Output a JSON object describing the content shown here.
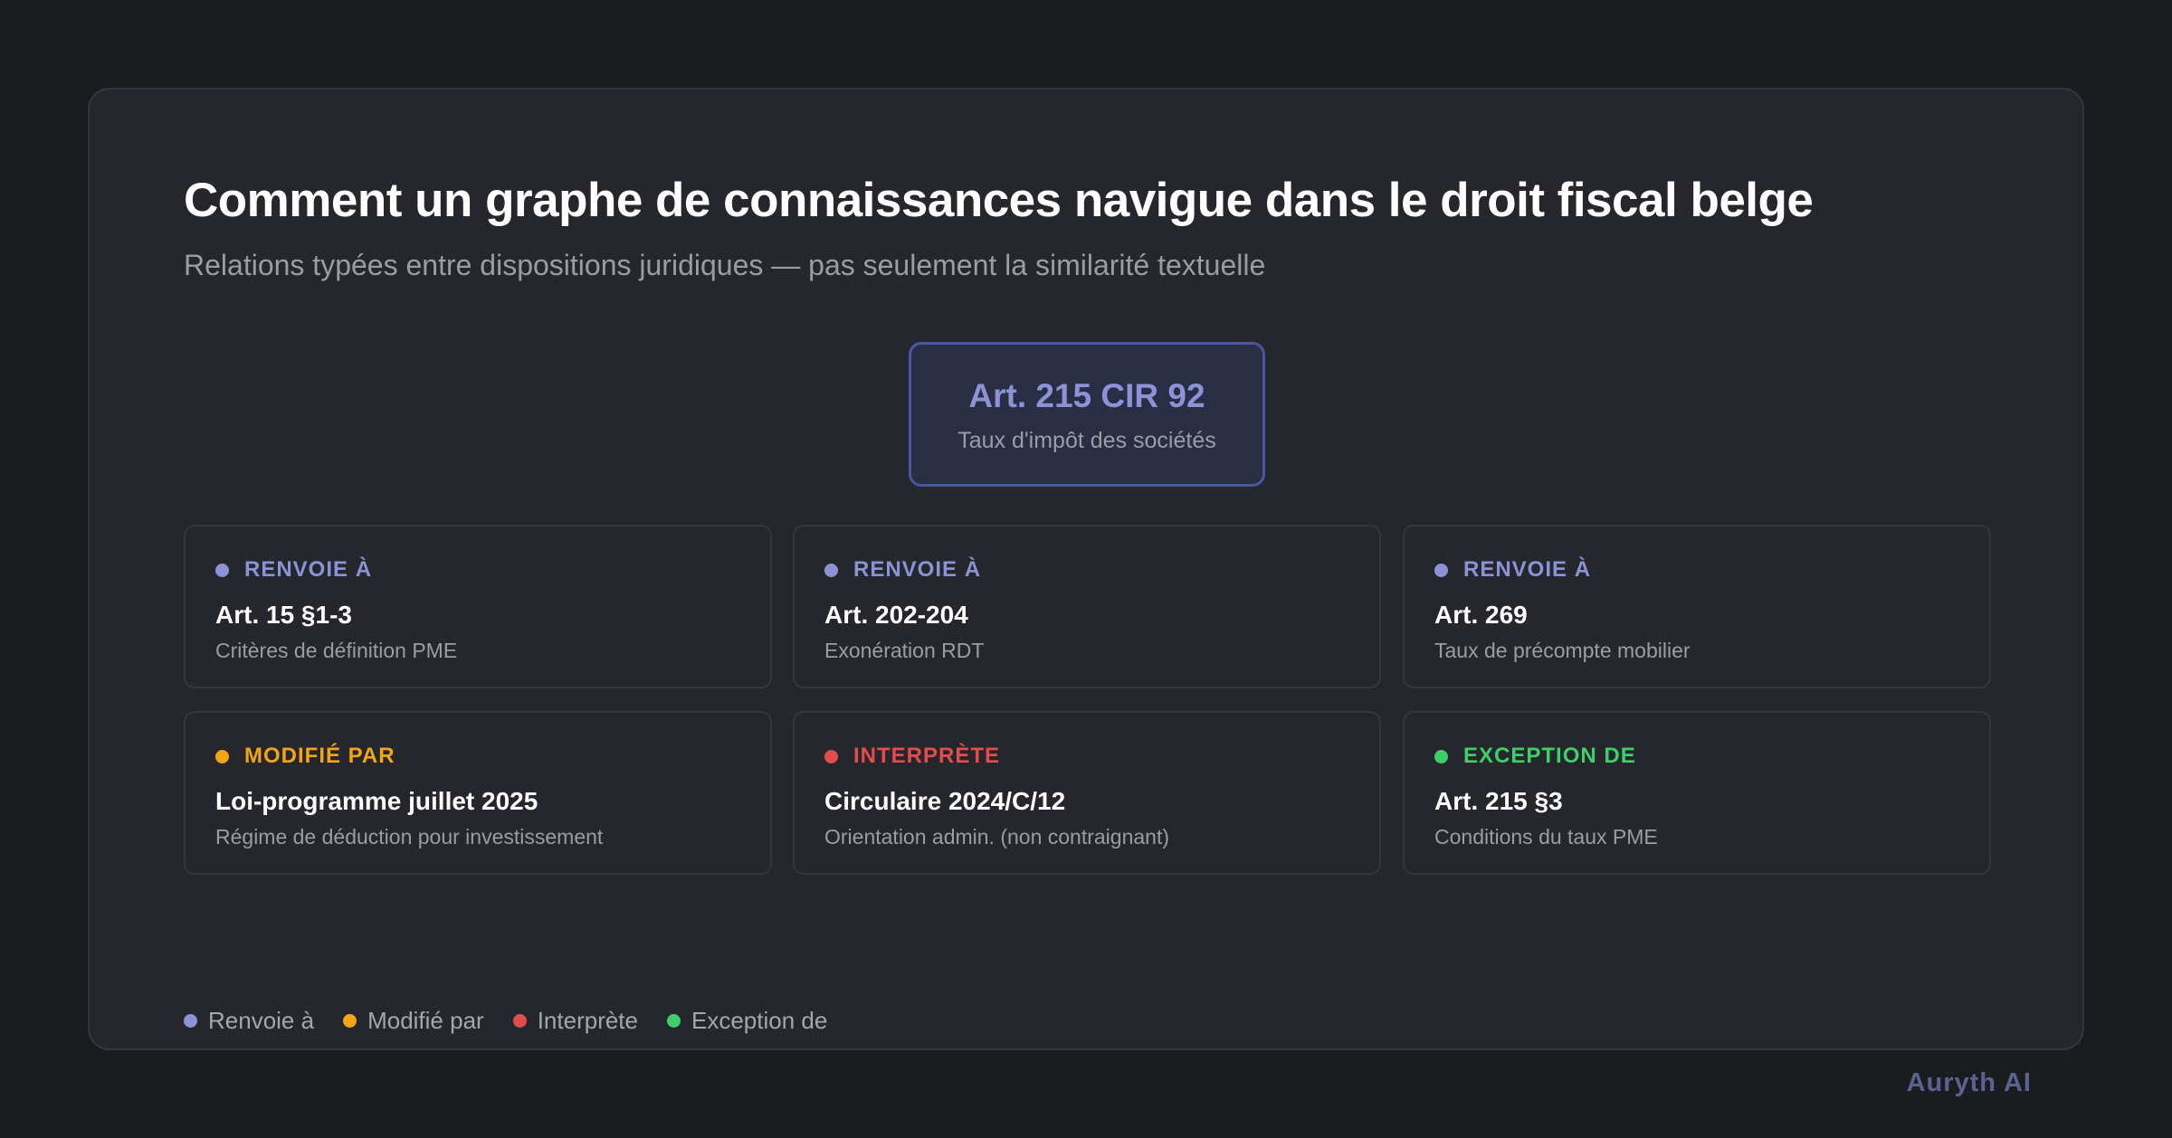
{
  "header": {
    "title": "Comment un graphe de connaissances navigue dans le droit fiscal belge",
    "subtitle": "Relations typées entre dispositions juridiques — pas seulement la similarité textuelle"
  },
  "center_node": {
    "title": "Art. 215 CIR 92",
    "subtitle": "Taux d'impôt des sociétés",
    "color": "#8b93d6"
  },
  "relations": [
    {
      "type": "RENVOIE À",
      "color": "#8b93d6",
      "title": "Art. 15 §1-3",
      "description": "Critères de définition PME"
    },
    {
      "type": "RENVOIE À",
      "color": "#8b93d6",
      "title": "Art. 202-204",
      "description": "Exonération RDT"
    },
    {
      "type": "RENVOIE À",
      "color": "#8b93d6",
      "title": "Art. 269",
      "description": "Taux de précompte mobilier"
    },
    {
      "type": "MODIFIÉ PAR",
      "color": "#f2a516",
      "title": "Loi-programme juillet 2025",
      "description": "Régime de déduction pour investissement"
    },
    {
      "type": "INTERPRÈTE",
      "color": "#e14d4d",
      "title": "Circulaire 2024/C/12",
      "description": "Orientation admin. (non contraignant)"
    },
    {
      "type": "EXCEPTION DE",
      "color": "#3ecf6b",
      "title": "Art. 215 §3",
      "description": "Conditions du taux PME"
    }
  ],
  "legend": [
    {
      "label": "Renvoie à",
      "color": "#8b93d6"
    },
    {
      "label": "Modifié par",
      "color": "#f2a516"
    },
    {
      "label": "Interprète",
      "color": "#e14d4d"
    },
    {
      "label": "Exception de",
      "color": "#3ecf6b"
    }
  ],
  "brand": "Auryth AI"
}
